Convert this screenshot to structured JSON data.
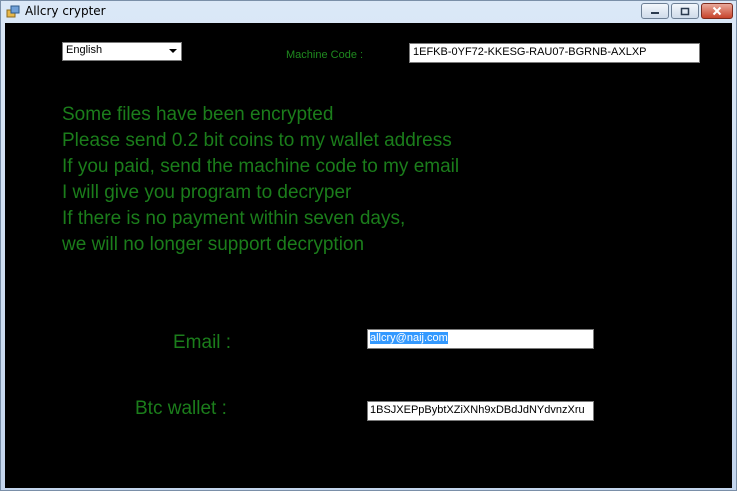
{
  "window": {
    "title": "Allcry crypter"
  },
  "language": {
    "selected": "English"
  },
  "machine_code": {
    "label": "Machine Code :",
    "value": "1EFKB-0YF72-KKESG-RAU07-BGRNB-AXLXP"
  },
  "message": {
    "lines": [
      "Some files have been encrypted",
      "Please send 0.2 bit coins to my wallet address",
      "If you paid, send the machine code to my email",
      "I will give you program to decryper",
      "If there is no payment within seven days,",
      "we will no longer support decryption"
    ]
  },
  "email": {
    "label": "Email :",
    "value": "allcry@naij.com"
  },
  "btc": {
    "label": "Btc wallet :",
    "value": "1BSJXEPpBybtXZiXNh9xDBdJdNYdvnzXru"
  },
  "colors": {
    "background": "#000000",
    "text_green": "#1b7d1b",
    "selection": "#3399ff"
  }
}
